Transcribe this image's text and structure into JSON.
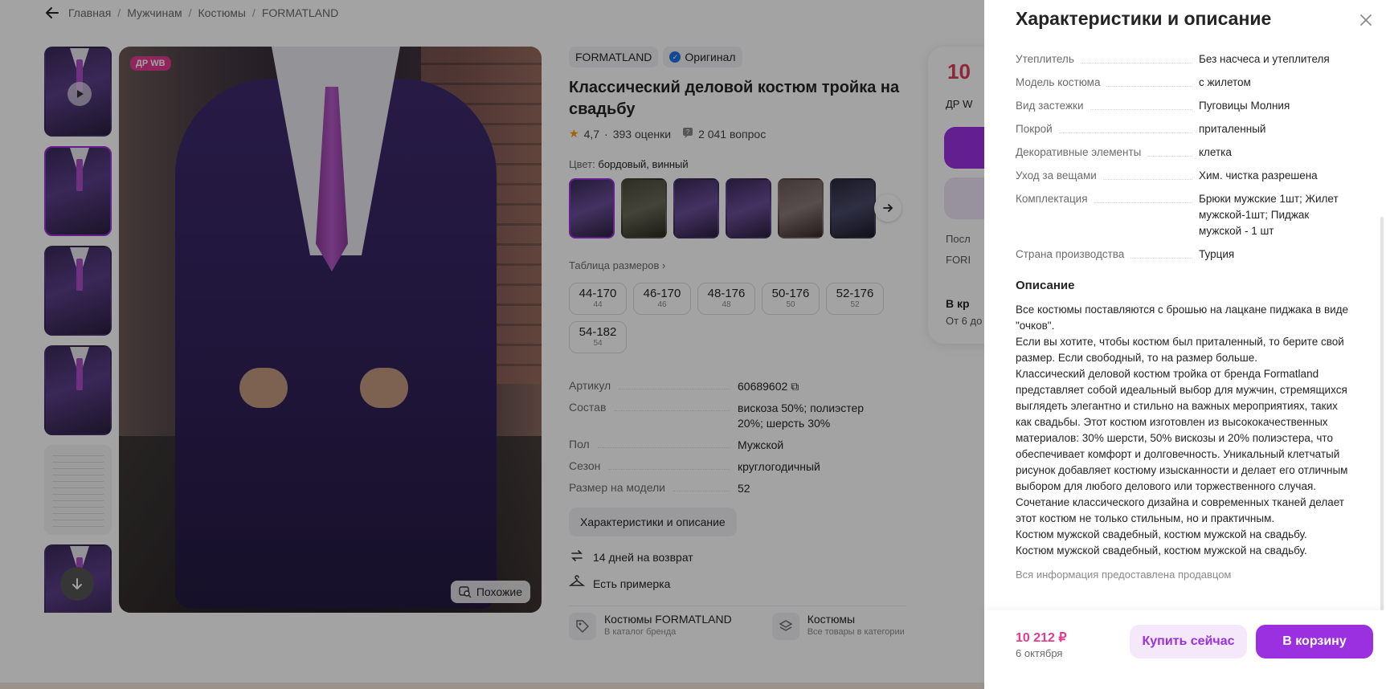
{
  "breadcrumb": {
    "items": [
      "Главная",
      "Мужчинам",
      "Костюмы",
      "FORMATLAND"
    ]
  },
  "gallery": {
    "badge": "ДР WB",
    "similar_label": "Похожие"
  },
  "product": {
    "brand": "FORMATLAND",
    "original_label": "Оригинал",
    "title": "Классический деловой костюм тройка на свадьбу",
    "rating": "4,7",
    "reviews": "393 оценки",
    "questions": "2 041 вопрос",
    "color_label": "Цвет:",
    "color_value": "бордовый, винный",
    "size_table_label": "Таблица размеров",
    "sizes": [
      {
        "main": "44-170",
        "sub": "44"
      },
      {
        "main": "46-170",
        "sub": "46"
      },
      {
        "main": "48-176",
        "sub": "48"
      },
      {
        "main": "50-176",
        "sub": "50"
      },
      {
        "main": "52-176",
        "sub": "52"
      },
      {
        "main": "54-182",
        "sub": "54"
      }
    ],
    "specs": [
      {
        "key": "Артикул",
        "value": "60689602"
      },
      {
        "key": "Состав",
        "value": "вискоза 50%; полиэстер 20%; шерсть 30%"
      },
      {
        "key": "Пол",
        "value": "Мужской"
      },
      {
        "key": "Сезон",
        "value": "круглогодичный"
      },
      {
        "key": "Размер на модели",
        "value": "52"
      }
    ],
    "char_button": "Характеристики и описание",
    "return_label": "14 дней на возврат",
    "fitting_label": "Есть примерка"
  },
  "links": [
    {
      "title": "Костюмы FORMATLAND",
      "sub": "В каталог бренда"
    },
    {
      "title": "Костюмы",
      "sub": "Все товары в категории"
    }
  ],
  "buy_card": {
    "price_partial": "10",
    "badge_partial": "ДР W",
    "line1_partial": "Посл",
    "line2_partial": "FORI",
    "cart_partial": "В кр",
    "delivery_partial": "От 6 до"
  },
  "drawer": {
    "title": "Характеристики и описание",
    "rows": [
      {
        "key": "Утеплитель",
        "value": "Без насчеса и утеплителя"
      },
      {
        "key": "Модель костюма",
        "value": "с жилетом"
      },
      {
        "key": "Вид застежки",
        "value": "Пуговицы Молния"
      },
      {
        "key": "Покрой",
        "value": "приталенный"
      },
      {
        "key": "Декоративные элементы",
        "value": "клетка"
      },
      {
        "key": "Уход за вещами",
        "value": "Хим. чистка разрешена"
      },
      {
        "key": "Комплектация",
        "value": "Брюки мужские 1шт; Жилет мужской-1шт; Пиджак мужской - 1 шт"
      },
      {
        "key": "Страна производства",
        "value": "Турция"
      }
    ],
    "description_title": "Описание",
    "description": "Все костюмы поставляются с брошью на лацкане пиджака в виде \"очков\".\nЕсли вы хотите, чтобы костюм был приталенный, то берите свой размер. Если свободный, то на размер больше.\nКлассический деловой костюм тройка от бренда Formatland представляет собой идеальный выбор для мужчин, стремящихся выглядеть элегантно и стильно на важных мероприятиях, таких как свадьбы. Этот костюм изготовлен из высококачественных материалов: 30% шерсти, 50% вискозы и 20% полиэстера, что обеспечивает комфорт и долговечность. Уникальный клетчатый рисунок добавляет костюму изысканности и делает его отличным выбором для любого делового или торжественного случая. Сочетание классического дизайна и современных тканей делает этот костюм не только стильным, но и практичным.\nКостюм мужской свадебный, костюм мужской на свадьбу.\nКостюм мужской свадебный, костюм мужской на свадьбу.",
    "footer_note": "Вся информация предоставлена продавцом",
    "price": "10 212 ₽",
    "date": "6 октября",
    "buy_now": "Купить сейчас",
    "add_to_cart": "В корзину"
  },
  "colors": {
    "accent": "#9b30e0",
    "price": "#e23c8f",
    "dimmer": "rgba(0,0,0,0.36)"
  }
}
